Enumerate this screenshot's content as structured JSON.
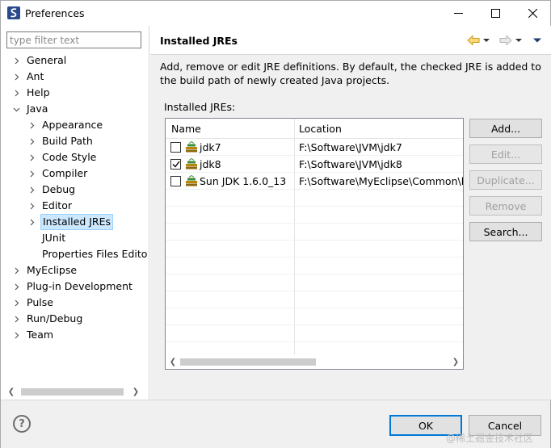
{
  "window": {
    "title": "Preferences"
  },
  "filter": {
    "placeholder": "type filter text"
  },
  "tree": [
    {
      "label": "General",
      "level": 0,
      "expandable": true,
      "expanded": false
    },
    {
      "label": "Ant",
      "level": 0,
      "expandable": true,
      "expanded": false
    },
    {
      "label": "Help",
      "level": 0,
      "expandable": true,
      "expanded": false
    },
    {
      "label": "Java",
      "level": 0,
      "expandable": true,
      "expanded": true
    },
    {
      "label": "Appearance",
      "level": 1,
      "expandable": true,
      "expanded": false
    },
    {
      "label": "Build Path",
      "level": 1,
      "expandable": true,
      "expanded": false
    },
    {
      "label": "Code Style",
      "level": 1,
      "expandable": true,
      "expanded": false
    },
    {
      "label": "Compiler",
      "level": 1,
      "expandable": true,
      "expanded": false
    },
    {
      "label": "Debug",
      "level": 1,
      "expandable": true,
      "expanded": false
    },
    {
      "label": "Editor",
      "level": 1,
      "expandable": true,
      "expanded": false
    },
    {
      "label": "Installed JREs",
      "level": 1,
      "expandable": true,
      "expanded": false,
      "selected": true
    },
    {
      "label": "JUnit",
      "level": 1,
      "expandable": false
    },
    {
      "label": "Properties Files Edito",
      "level": 1,
      "expandable": false
    },
    {
      "label": "MyEclipse",
      "level": 0,
      "expandable": true,
      "expanded": false
    },
    {
      "label": "Plug-in Development",
      "level": 0,
      "expandable": true,
      "expanded": false
    },
    {
      "label": "Pulse",
      "level": 0,
      "expandable": true,
      "expanded": false
    },
    {
      "label": "Run/Debug",
      "level": 0,
      "expandable": true,
      "expanded": false
    },
    {
      "label": "Team",
      "level": 0,
      "expandable": true,
      "expanded": false
    }
  ],
  "page": {
    "title": "Installed JREs",
    "description": "Add, remove or edit JRE definitions. By default, the checked JRE is added to the build path of newly created Java projects.",
    "list_label": "Installed JREs:"
  },
  "table": {
    "columns": [
      "Name",
      "Location"
    ],
    "rows": [
      {
        "name": "jdk7",
        "location": "F:\\Software\\JVM\\jdk7",
        "checked": false
      },
      {
        "name": "jdk8",
        "location": "F:\\Software\\JVM\\jdk8",
        "checked": true
      },
      {
        "name": "Sun JDK 1.6.0_13",
        "location": "F:\\Software\\MyEclipse\\Common\\bi",
        "checked": false
      }
    ]
  },
  "buttons": {
    "add": "Add...",
    "edit": "Edit...",
    "duplicate": "Duplicate...",
    "remove": "Remove",
    "search": "Search..."
  },
  "footer": {
    "ok": "OK",
    "cancel": "Cancel",
    "help": "?"
  },
  "watermark": "@稀土掘金技术社区",
  "colors": {
    "selection": "#cce8ff",
    "default_button_border": "#0078d7",
    "panel": "#f0f0f0"
  }
}
